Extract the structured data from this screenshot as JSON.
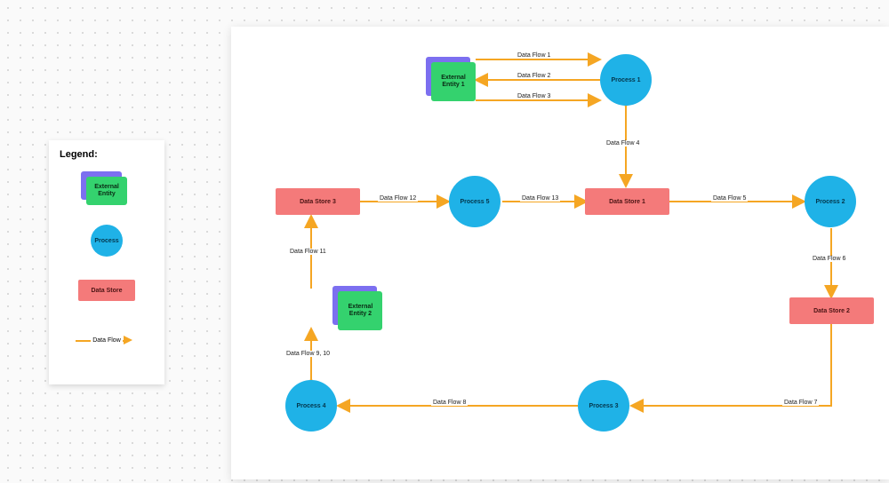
{
  "legend": {
    "title": "Legend:",
    "external_entity": "External Entity",
    "process": "Process",
    "data_store": "Data Store",
    "data_flow": "Data Flow"
  },
  "nodes": {
    "ext1": "External Entity 1",
    "ext2": "External Entity 2",
    "p1": "Process 1",
    "p2": "Process 2",
    "p3": "Process 3",
    "p4": "Process 4",
    "p5": "Process 5",
    "ds1": "Data Store 1",
    "ds2": "Data Store 2",
    "ds3": "Data Store 3"
  },
  "flows": {
    "f1": "Data Flow 1",
    "f2": "Data Flow 2",
    "f3": "Data Flow 3",
    "f4": "Data Flow 4",
    "f5": "Data Flow 5",
    "f6": "Data Flow 6",
    "f7": "Data Flow 7",
    "f8": "Data Flow 8",
    "f9_10": "Data Flow 9, 10",
    "f11": "Data Flow 11",
    "f12": "Data Flow 12",
    "f13": "Data Flow 13"
  },
  "chart_data": {
    "type": "data-flow-diagram",
    "external_entities": [
      "External Entity 1",
      "External Entity 2"
    ],
    "processes": [
      "Process 1",
      "Process 2",
      "Process 3",
      "Process 4",
      "Process 5"
    ],
    "data_stores": [
      "Data Store 1",
      "Data Store 2",
      "Data Store 3"
    ],
    "edges": [
      {
        "label": "Data Flow 1",
        "from": "External Entity 1",
        "to": "Process 1",
        "bidirectional": false
      },
      {
        "label": "Data Flow 2",
        "from": "Process 1",
        "to": "External Entity 1",
        "bidirectional": false
      },
      {
        "label": "Data Flow 3",
        "from": "External Entity 1",
        "to": "Process 1",
        "bidirectional": false
      },
      {
        "label": "Data Flow 4",
        "from": "Process 1",
        "to": "Data Store 1",
        "bidirectional": true
      },
      {
        "label": "Data Flow 5",
        "from": "Data Store 1",
        "to": "Process 2",
        "bidirectional": false
      },
      {
        "label": "Data Flow 6",
        "from": "Process 2",
        "to": "Data Store 2",
        "bidirectional": false
      },
      {
        "label": "Data Flow 7",
        "from": "Data Store 2",
        "to": "Process 3",
        "bidirectional": false
      },
      {
        "label": "Data Flow 8",
        "from": "Process 3",
        "to": "Process 4",
        "bidirectional": false
      },
      {
        "label": "Data Flow 9, 10",
        "from": "Process 4",
        "to": "External Entity 2",
        "bidirectional": true
      },
      {
        "label": "Data Flow 11",
        "from": "External Entity 2",
        "to": "Data Store 3",
        "bidirectional": false
      },
      {
        "label": "Data Flow 12",
        "from": "Data Store 3",
        "to": "Process 5",
        "bidirectional": false
      },
      {
        "label": "Data Flow 13",
        "from": "Process 5",
        "to": "Data Store 1",
        "bidirectional": false
      }
    ],
    "colors": {
      "external_entity_front": "#34d26e",
      "external_entity_back": "#7c6ff0",
      "process": "#1fb2e7",
      "data_store": "#f47a7a",
      "flow": "#f5a623"
    }
  }
}
